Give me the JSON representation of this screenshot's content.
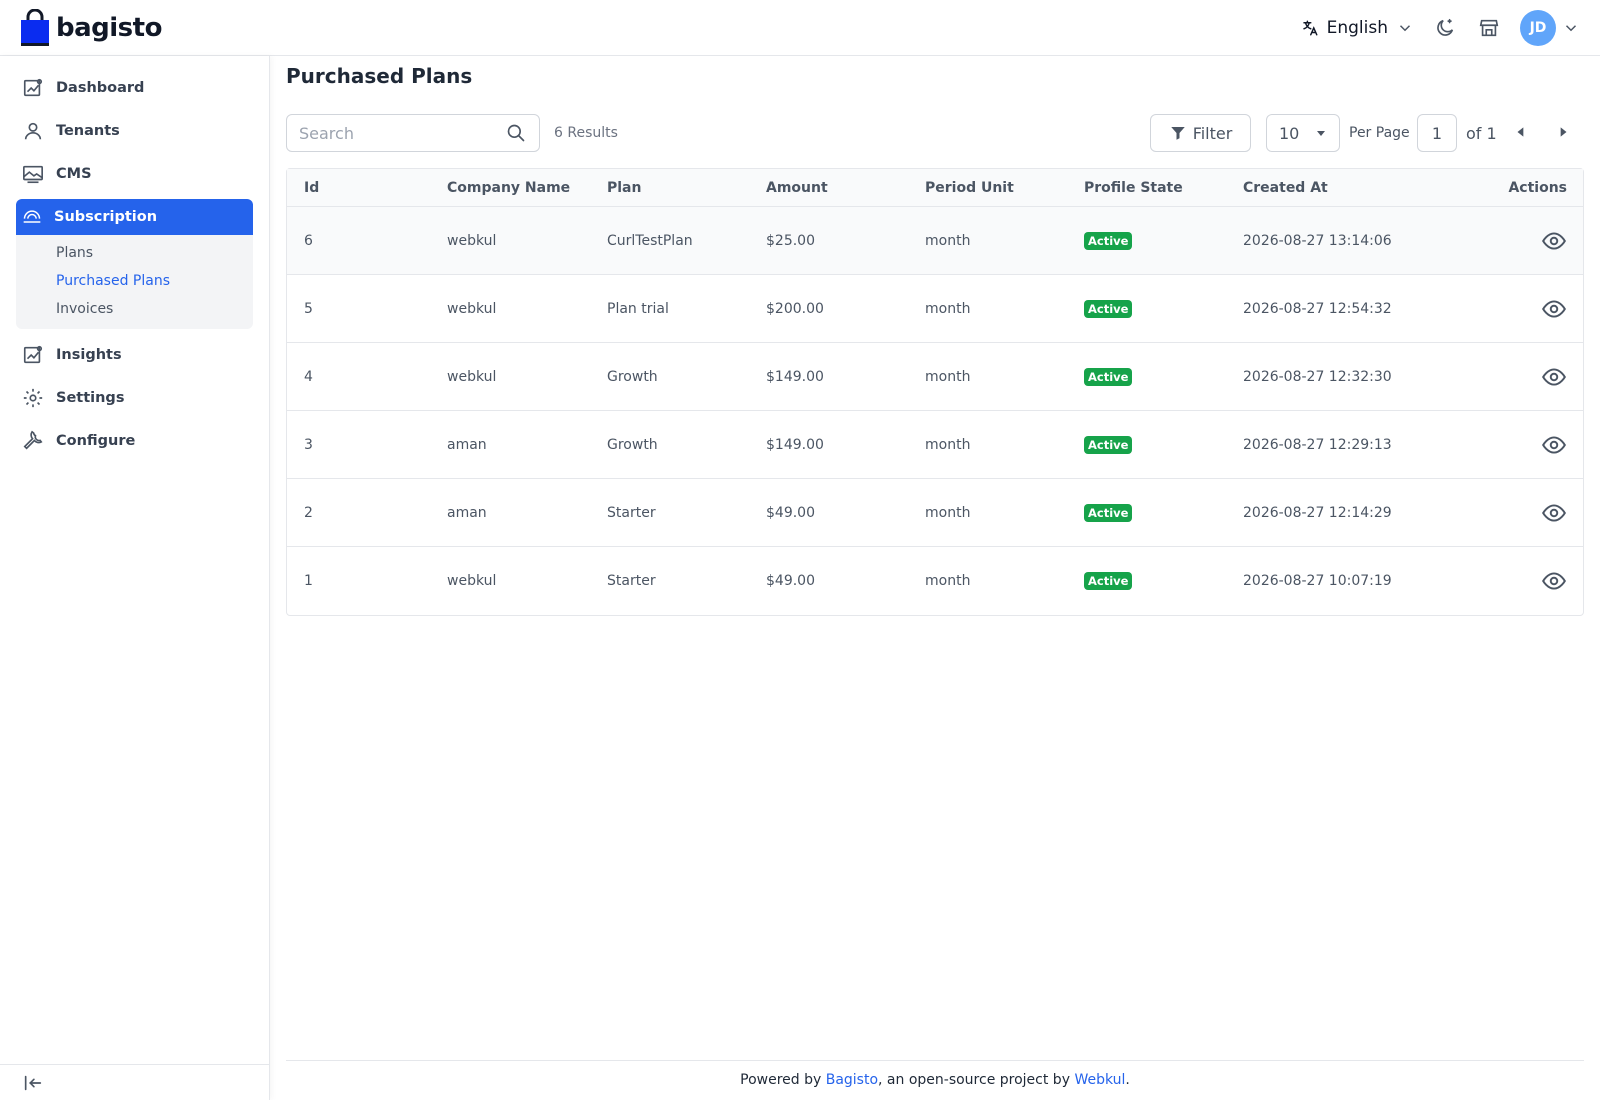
{
  "header": {
    "logo_text": "bagisto",
    "language": "English",
    "avatar_initials": "JD"
  },
  "sidebar": {
    "items": [
      {
        "label": "Dashboard",
        "icon": "dashboard-icon"
      },
      {
        "label": "Tenants",
        "icon": "user-icon"
      },
      {
        "label": "CMS",
        "icon": "image-icon"
      },
      {
        "label": "Subscription",
        "icon": "subscription-icon",
        "active": true
      },
      {
        "label": "Insights",
        "icon": "chart-icon"
      },
      {
        "label": "Settings",
        "icon": "gear-icon"
      },
      {
        "label": "Configure",
        "icon": "wrench-icon"
      }
    ],
    "subscription_children": [
      {
        "label": "Plans"
      },
      {
        "label": "Purchased Plans",
        "active": true
      },
      {
        "label": "Invoices"
      }
    ]
  },
  "main": {
    "title": "Purchased Plans",
    "search_placeholder": "Search",
    "results_text": "6 Results",
    "filter_label": "Filter",
    "per_page_value": "10",
    "per_page_label": "Per Page",
    "page_value": "1",
    "of_label": "of 1"
  },
  "table": {
    "columns": [
      "Id",
      "Company Name",
      "Plan",
      "Amount",
      "Period Unit",
      "Profile State",
      "Created At",
      "Actions"
    ],
    "rows": [
      {
        "id": "6",
        "company": "webkul",
        "plan": "CurlTestPlan",
        "amount": "$25.00",
        "period": "month",
        "state": "Active",
        "created": "2026-08-27 13:14:06"
      },
      {
        "id": "5",
        "company": "webkul",
        "plan": "Plan trial",
        "amount": "$200.00",
        "period": "month",
        "state": "Active",
        "created": "2026-08-27 12:54:32"
      },
      {
        "id": "4",
        "company": "webkul",
        "plan": "Growth",
        "amount": "$149.00",
        "period": "month",
        "state": "Active",
        "created": "2026-08-27 12:32:30"
      },
      {
        "id": "3",
        "company": "aman",
        "plan": "Growth",
        "amount": "$149.00",
        "period": "month",
        "state": "Active",
        "created": "2026-08-27 12:29:13"
      },
      {
        "id": "2",
        "company": "aman",
        "plan": "Starter",
        "amount": "$49.00",
        "period": "month",
        "state": "Active",
        "created": "2026-08-27 12:14:29"
      },
      {
        "id": "1",
        "company": "webkul",
        "plan": "Starter",
        "amount": "$49.00",
        "period": "month",
        "state": "Active",
        "created": "2026-08-27 10:07:19"
      }
    ]
  },
  "footer": {
    "prefix": "Powered by ",
    "link1": "Bagisto",
    "middle": ", an open-source project by ",
    "link2": "Webkul",
    "suffix": "."
  },
  "colors": {
    "accent": "#2563eb",
    "active_badge": "#16a34a",
    "avatar": "#60a5fa"
  }
}
